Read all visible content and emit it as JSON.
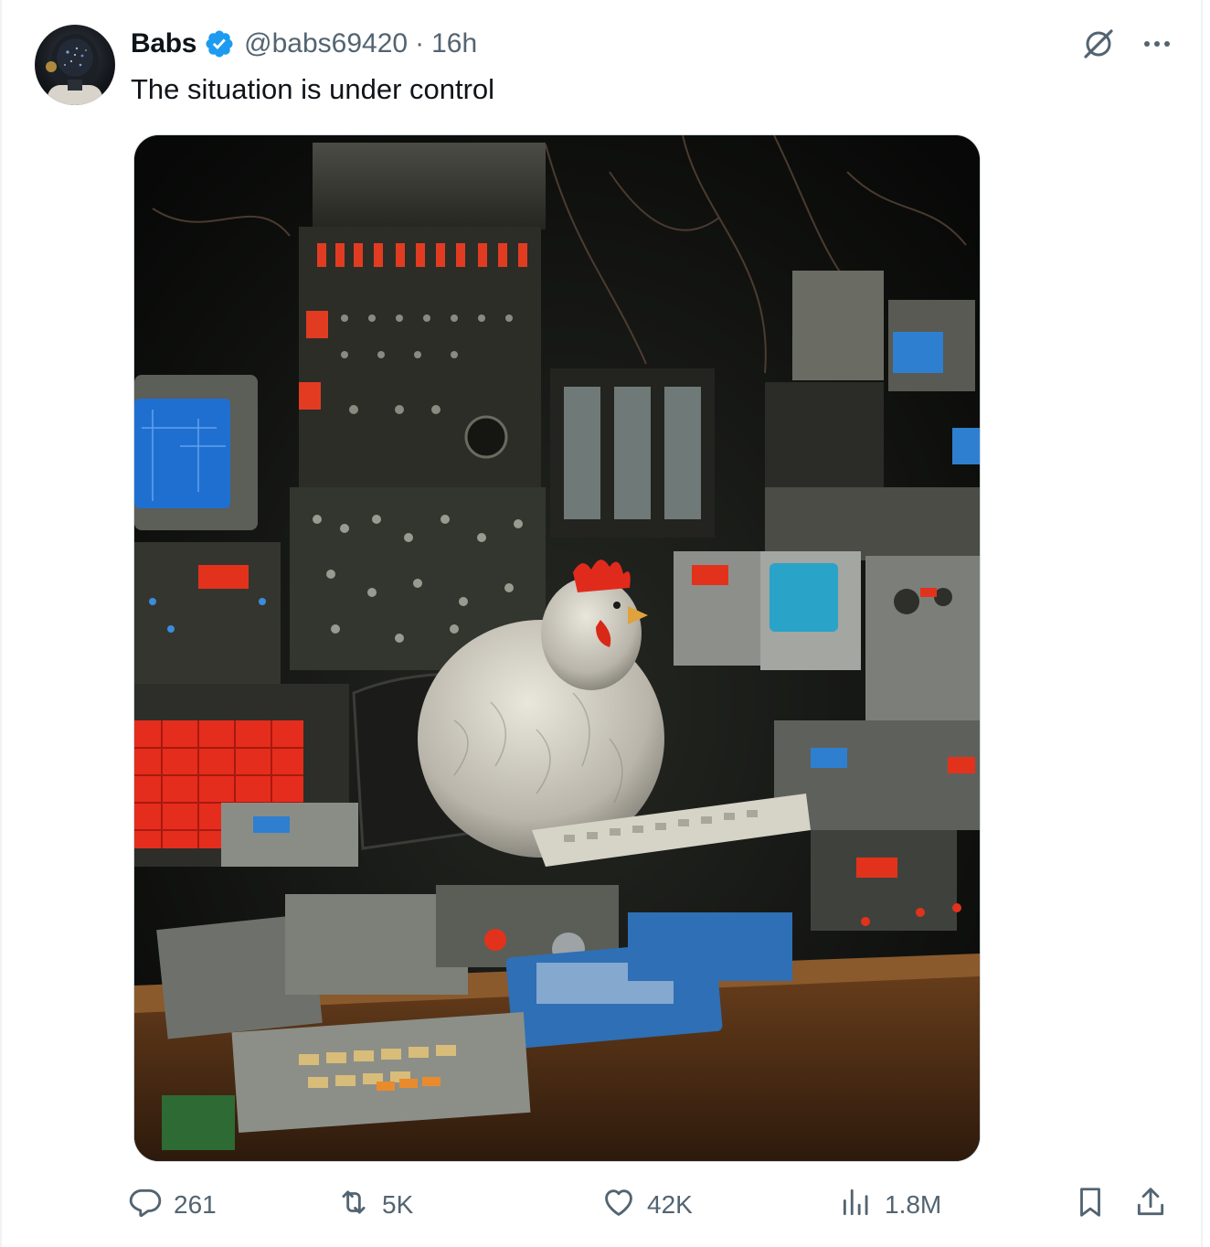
{
  "tweet": {
    "author_name": "Babs",
    "handle": "@babs69420",
    "separator": "·",
    "time": "16h",
    "text": "The situation is under control"
  },
  "icons": {
    "verified": "verified-badge-icon",
    "grok": "grok-icon",
    "more": "more-horizontal-icon",
    "reply": "reply-icon",
    "retweet": "retweet-icon",
    "like": "heart-icon",
    "views": "views-chart-icon",
    "bookmark": "bookmark-icon",
    "share": "share-icon"
  },
  "actions": {
    "replies": "261",
    "reposts": "5K",
    "likes": "42K",
    "views": "1.8M"
  },
  "colors": {
    "verified_blue": "#1d9bf0",
    "secondary_text": "#536471",
    "primary_text": "#0f1419"
  }
}
